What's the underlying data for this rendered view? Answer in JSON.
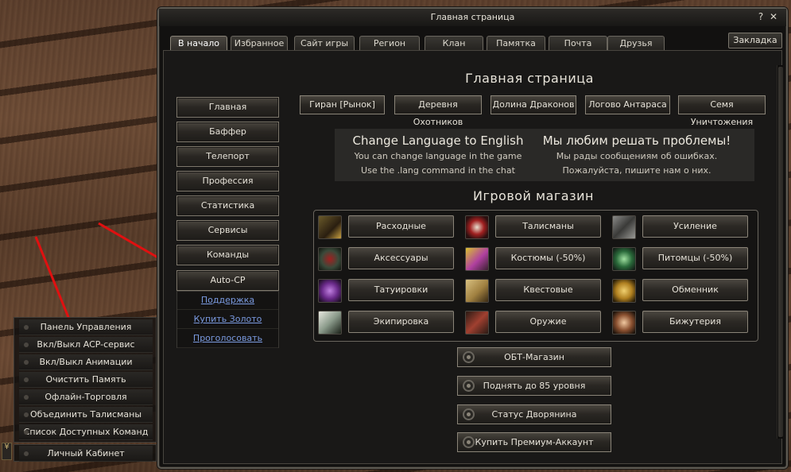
{
  "side_panel": {
    "items": [
      "Панель Управления",
      "Вкл/Выкл ACP-сервис",
      "Вкл/Выкл Анимации",
      "Очистить Память",
      "Офлайн-Торговля",
      "Объединить Талисманы",
      "Список Доступных Команд"
    ],
    "bottom_item": "Личный Кабинет",
    "toggle_glyph": "¥"
  },
  "window": {
    "title": "Главная страница",
    "help_glyph": "?",
    "close_glyph": "✕",
    "bookmark": "Закладка",
    "tabs": [
      "В начало",
      "Избранное",
      "Сайт игры",
      "Регион",
      "Клан",
      "Памятка",
      "Почта",
      "Друзья"
    ]
  },
  "nav": {
    "buttons": [
      "Главная",
      "Баффер",
      "Телепорт",
      "Профессия",
      "Статистика",
      "Сервисы",
      "Команды",
      "Auto-CP"
    ],
    "links": [
      "Поддержка",
      "Купить Золото",
      "Проголосовать"
    ]
  },
  "main": {
    "heading": "Главная страница",
    "locations": [
      "Гиран [Рынок]",
      "Деревня Охотников",
      "Долина Драконов",
      "Логово Антараса",
      "Семя Уничтожения"
    ],
    "info_left": {
      "title": "Change Language to English",
      "line1": "You can change language in the game",
      "line2": "Use the .lang command in the chat"
    },
    "info_right": {
      "title": "Мы любим решать проблемы!",
      "line1": "Мы рады сообщениям об ошибках.",
      "line2": "Пожалуйста, пишите нам о них."
    },
    "shop_heading": "Игровой магазин",
    "shop_items": [
      "Расходные",
      "Талисманы",
      "Усиление",
      "Аксессуары",
      "Костюмы (-50%)",
      "Питомцы (-50%)",
      "Татуировки",
      "Квестовые",
      "Обменник",
      "Экипировка",
      "Оружие",
      "Бижутерия"
    ],
    "shop_icons": [
      "scroll-staff-icon",
      "talisman-icon",
      "enchant-scroll-icon",
      "helmet-icon",
      "costume-icon",
      "pet-icon",
      "potion-icon",
      "quest-scroll-icon",
      "coin-icon",
      "armor-icon",
      "weapon-icon",
      "jewelry-icon"
    ],
    "extra_buttons": [
      "ОБТ-Магазин",
      "Поднять до 85 уровня",
      "Статус Дворянина",
      "Купить Премиум-Аккаунт"
    ]
  },
  "colors": {
    "link": "#7a9ae0",
    "arrow": "#e01010",
    "button_border": "#8a8478"
  }
}
